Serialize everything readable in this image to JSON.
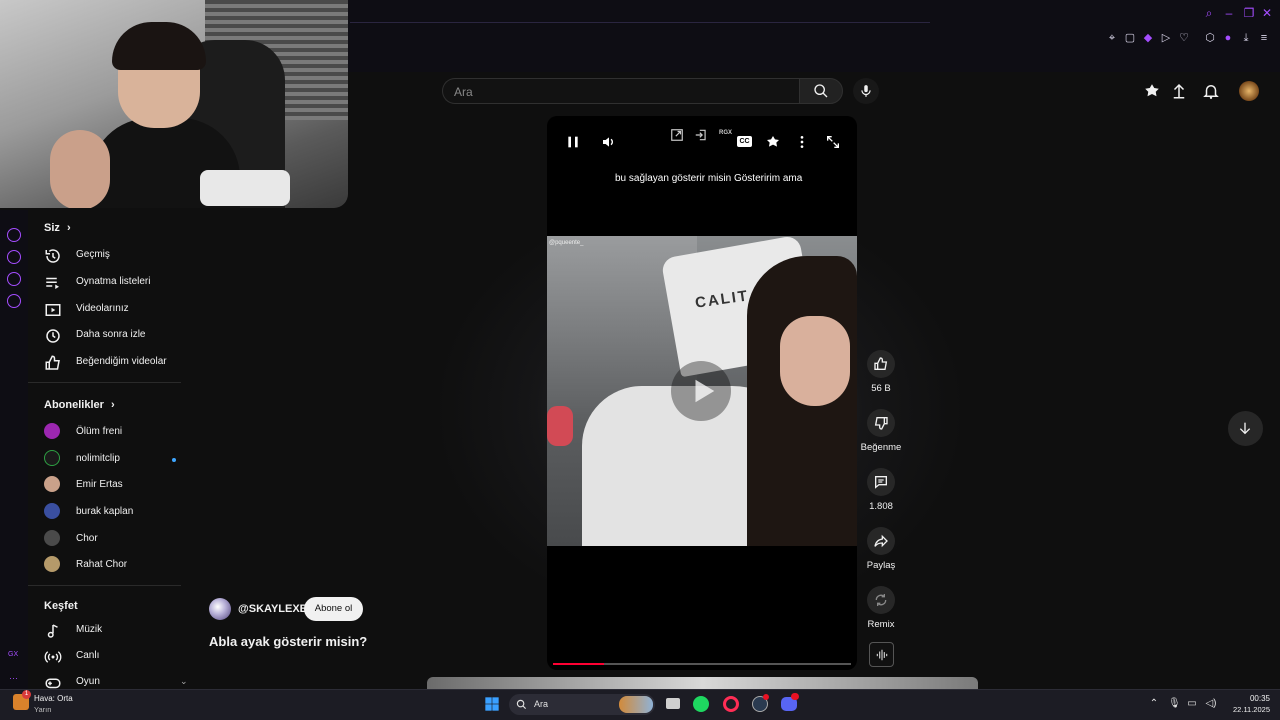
{
  "browser": {
    "name": "Opera GX",
    "side_label": "GX"
  },
  "header": {
    "search_placeholder": "Ara"
  },
  "sidebar": {
    "you_title": "Siz",
    "you_items": [
      {
        "label": "Geçmiş",
        "icon": "history-icon"
      },
      {
        "label": "Oynatma listeleri",
        "icon": "playlists-icon"
      },
      {
        "label": "Videolarınız",
        "icon": "your-videos-icon"
      },
      {
        "label": "Daha sonra izle",
        "icon": "watch-later-icon"
      },
      {
        "label": "Beğendiğim videolar",
        "icon": "liked-videos-icon"
      }
    ],
    "subs_title": "Abonelikler",
    "subscriptions": [
      {
        "label": "Ölüm freni",
        "color": "#9c27b0",
        "has_new": false
      },
      {
        "label": "nolimitclip",
        "color": "#1a1a1a",
        "has_new": true
      },
      {
        "label": "Emir Ertas",
        "color": "#c9a18a",
        "has_new": false
      },
      {
        "label": "burak kaplan",
        "color": "#3a4fa0",
        "has_new": false
      },
      {
        "label": "Chor",
        "color": "#4a4a4a",
        "has_new": false
      },
      {
        "label": "Rahat Chor",
        "color": "#b59a6a",
        "has_new": false
      }
    ],
    "explore_title": "Keşfet",
    "explore_items": [
      {
        "label": "Müzik",
        "icon": "music-icon"
      },
      {
        "label": "Canlı",
        "icon": "live-icon"
      },
      {
        "label": "Oyun",
        "icon": "gaming-icon"
      }
    ]
  },
  "player": {
    "subtitle": "bu sağlayan gösterir misin Gösteririm ama",
    "video_tag": "@pqueente_",
    "chair_text": "CALIT",
    "progress": 0.17
  },
  "actions": {
    "likes": "56 B",
    "dislike_label": "Beğenme",
    "comments": "1.808",
    "share_label": "Paylaş",
    "remix_label": "Remix"
  },
  "channel": {
    "handle": "@SKAYLEXE",
    "subscribe_label": "Abone ol",
    "video_title": "Abla ayak gösterir misin?"
  },
  "taskbar": {
    "weather_line1": "Hava: Orta",
    "weather_line2": "Yarın",
    "weather_badge": "1",
    "search_label": "Ara",
    "time": "00:35",
    "date": "22.11.2025"
  },
  "colors": {
    "accent_gx": "#a44dff",
    "progress_red": "#ff0033",
    "background": "#0f0f0f"
  }
}
